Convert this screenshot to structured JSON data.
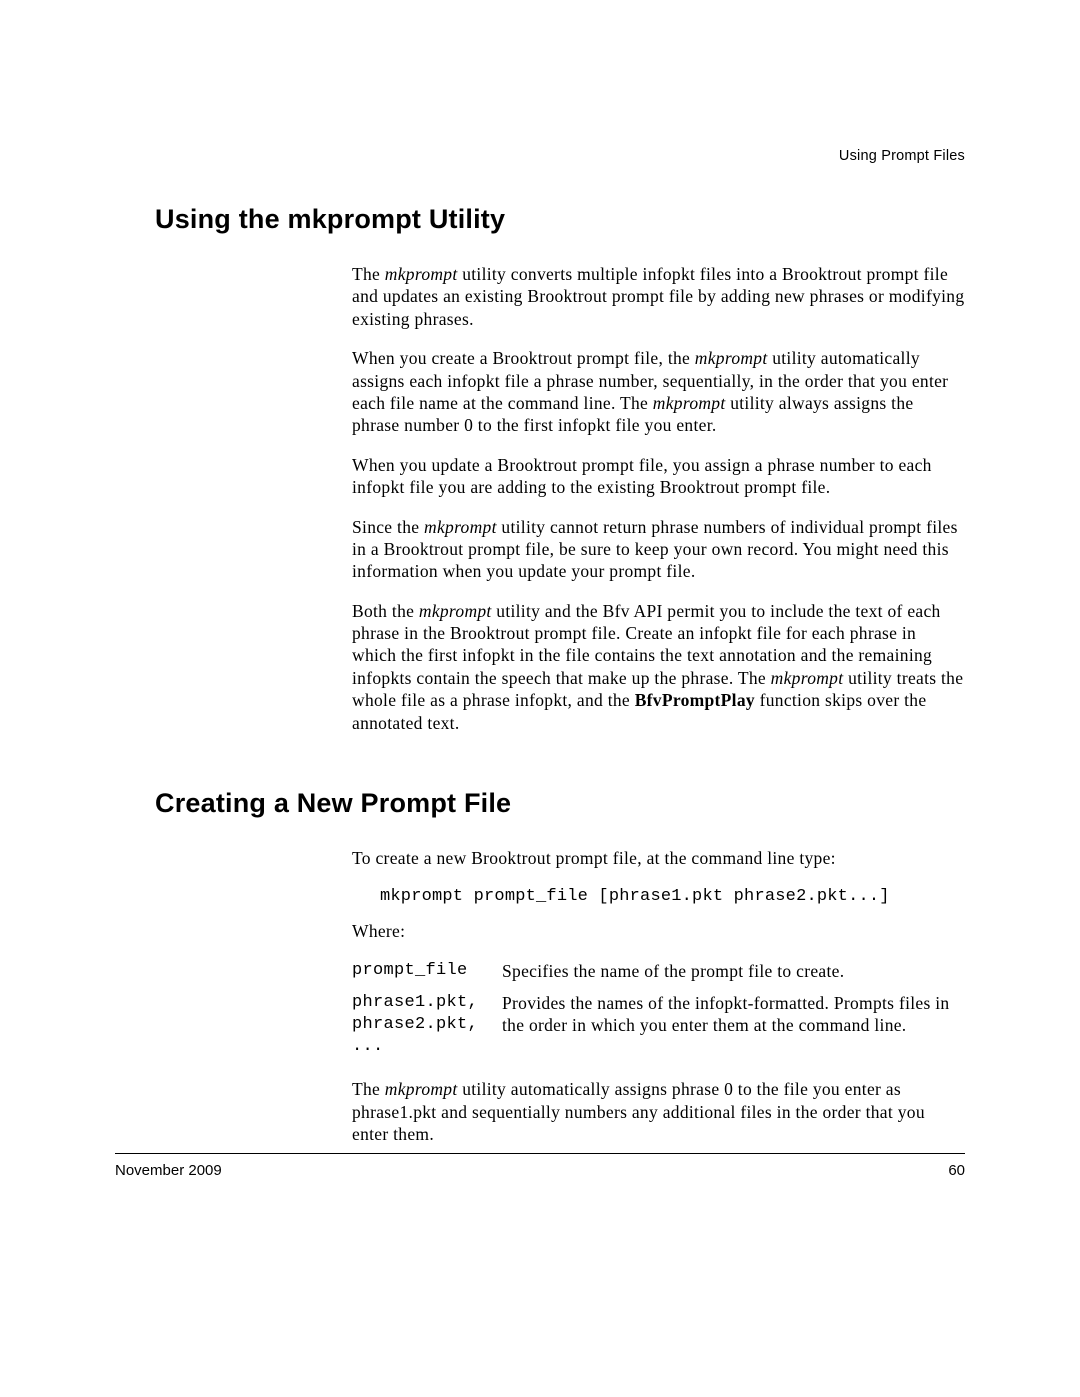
{
  "header": {
    "running": "Using Prompt Files"
  },
  "section1": {
    "title": "Using the mkprompt Utility",
    "p1_a": "The ",
    "p1_em1": "mkprompt",
    "p1_b": " utility converts multiple infopkt files into a Brooktrout prompt file and updates an existing Brooktrout prompt file by adding new phrases or modifying existing phrases.",
    "p2_a": "When you create a Brooktrout prompt file, the ",
    "p2_em1": "mkprompt",
    "p2_b": " utility automatically assigns each infopkt file a phrase number, sequentially, in the order that you enter each file name at the command line. The ",
    "p2_em2": "mkprompt",
    "p2_c": " utility always assigns the phrase number 0 to the first infopkt file you enter.",
    "p3": "When you update a Brooktrout prompt file, you assign a phrase number to each infopkt file you are adding to the existing Brooktrout prompt file.",
    "p4_a": "Since the ",
    "p4_em1": "mkprompt",
    "p4_b": " utility cannot return phrase numbers of individual prompt files in a Brooktrout prompt file, be sure to keep your own record. You might need this information when you update your prompt file.",
    "p5_a": "Both the ",
    "p5_em1": "mkprompt",
    "p5_b": " utility and the Bfv API permit you to include the text of each phrase in the Brooktrout prompt file. Create an infopkt file for each phrase in which the first infopkt in the file contains the text annotation and the remaining infopkts contain the speech that make up the phrase. The ",
    "p5_em2": "mkprompt",
    "p5_c": " utility treats the whole file as a phrase infopkt, and the ",
    "p5_strong": "BfvPromptPlay",
    "p5_d": " function skips over the annotated text."
  },
  "section2": {
    "title": "Creating a New Prompt File",
    "p1": "To create a new Brooktrout prompt file, at the command line type:",
    "cmd": "mkprompt prompt_file [phrase1.pkt phrase2.pkt...]",
    "where": "Where:",
    "defs": [
      {
        "term": "prompt_file",
        "desc": "Specifies the name of the prompt file to create."
      },
      {
        "term": "phrase1.pkt, phrase2.pkt, ...",
        "desc": "Provides the names of the infopkt-formatted. Prompts files in the order in which you enter them at the command line."
      }
    ],
    "p2_a": "The ",
    "p2_em1": "mkprompt",
    "p2_b": " utility automatically assigns phrase 0 to the file you enter as phrase1.pkt and sequentially numbers any additional files in the order that you enter them."
  },
  "footer": {
    "date": "November 2009",
    "page": "60"
  }
}
